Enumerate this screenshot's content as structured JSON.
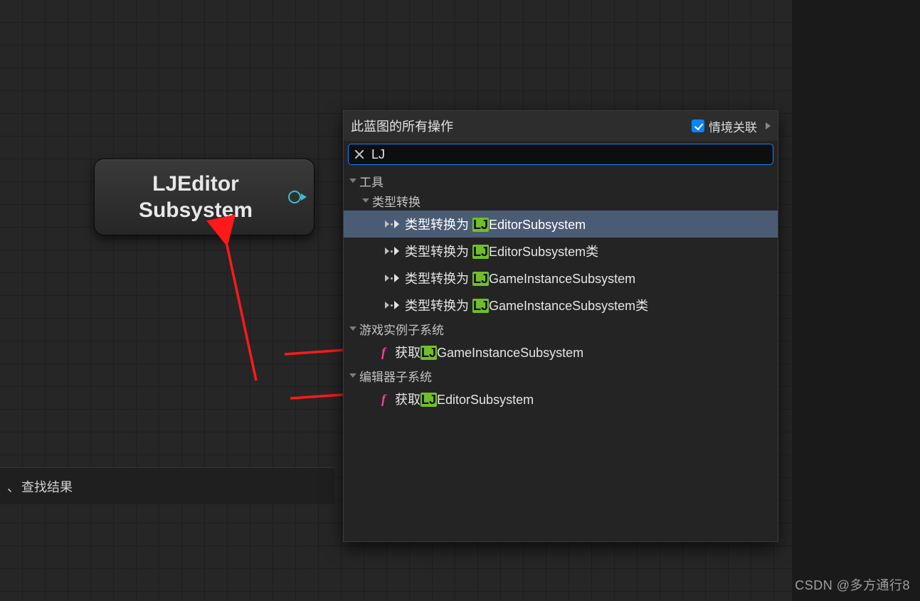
{
  "node": {
    "title_line1": "LJEditor",
    "title_line2": "Subsystem"
  },
  "bottom_tab": {
    "label": "查找结果"
  },
  "popup": {
    "title": "此蓝图的所有操作",
    "context_label": "情境关联",
    "context_checked": true,
    "search_value": "LJ",
    "categories": {
      "tools": "工具",
      "cast": "类型转换",
      "game_instance_sub": "游戏实例子系统",
      "editor_sub": "编辑器子系统"
    },
    "items": {
      "cast_editor": {
        "prefix": "类型转换为 ",
        "hl": "LJ",
        "suffix": "EditorSubsystem"
      },
      "cast_editor_class": {
        "prefix": "类型转换为 ",
        "hl": "LJ",
        "suffix": "EditorSubsystem类"
      },
      "cast_gi": {
        "prefix": "类型转换为 ",
        "hl": "LJ",
        "suffix": "GameInstanceSubsystem"
      },
      "cast_gi_class": {
        "prefix": "类型转换为 ",
        "hl": "LJ",
        "suffix": "GameInstanceSubsystem类"
      },
      "get_gi": {
        "prefix": "获取",
        "hl": "LJ",
        "suffix": "GameInstanceSubsystem"
      },
      "get_editor": {
        "prefix": "获取",
        "hl": "LJ",
        "suffix": "EditorSubsystem"
      }
    }
  },
  "watermark": "CSDN @多方通行8"
}
